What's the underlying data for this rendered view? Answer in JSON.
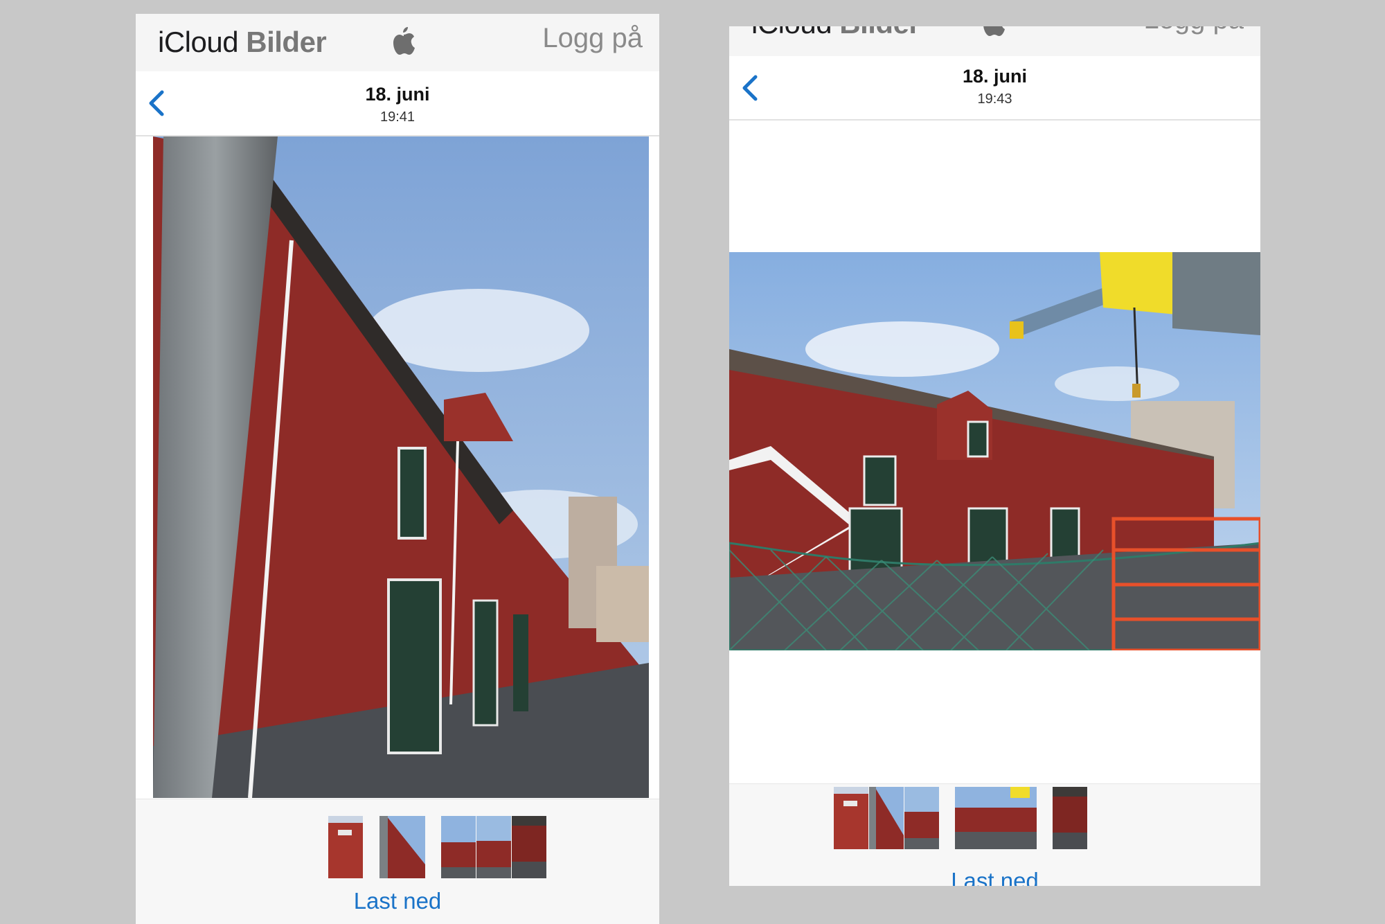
{
  "screens": [
    {
      "header": {
        "brand_icloud": "iCloud",
        "brand_bilder": "Bilder",
        "apple_logo": "apple-icon",
        "login_label": "Logg på"
      },
      "nav": {
        "back_icon": "chevron-left-icon",
        "date": "18. juni",
        "time": "19:41"
      },
      "photo": {
        "subject": "red-warehouse-portrait"
      },
      "filmstrip": {
        "thumb_count": 5
      },
      "download_label": "Last ned"
    },
    {
      "header": {
        "brand_icloud": "iCloud",
        "brand_bilder": "Bilder",
        "apple_logo": "apple-icon",
        "login_label": "Logg på"
      },
      "nav": {
        "back_icon": "chevron-left-icon",
        "date": "18. juni",
        "time": "19:43"
      },
      "photo": {
        "subject": "red-warehouse-landscape"
      },
      "filmstrip": {
        "thumb_count": 5
      },
      "download_label": "Last ned"
    }
  ],
  "colors": {
    "accent": "#1a73c8",
    "background": "#c8c8c8",
    "bar": "#f5f5f5",
    "barn_red": "#8e2b27",
    "sky": "#8fb3df"
  }
}
